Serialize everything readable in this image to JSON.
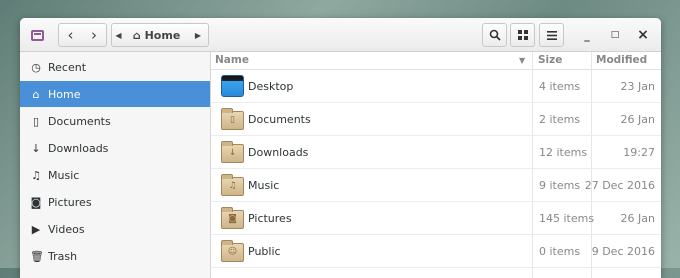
{
  "header": {
    "path_label": "Home",
    "window_controls": {
      "minimize": "_",
      "maximize": "□",
      "close": "×"
    }
  },
  "sidebar": {
    "items": [
      {
        "label": "Recent",
        "icon": "clock-icon"
      },
      {
        "label": "Home",
        "icon": "home-icon",
        "selected": true
      },
      {
        "label": "Documents",
        "icon": "document-icon"
      },
      {
        "label": "Downloads",
        "icon": "download-icon"
      },
      {
        "label": "Music",
        "icon": "music-icon"
      },
      {
        "label": "Pictures",
        "icon": "camera-icon"
      },
      {
        "label": "Videos",
        "icon": "video-icon"
      },
      {
        "label": "Trash",
        "icon": "trash-icon"
      }
    ]
  },
  "list": {
    "columns": {
      "name": "Name",
      "size": "Size",
      "modified": "Modified"
    },
    "rows": [
      {
        "name": "Desktop",
        "size": "4 items",
        "modified": "23 Jan",
        "icon": "desktop-folder-icon"
      },
      {
        "name": "Documents",
        "size": "2 items",
        "modified": "26 Jan",
        "icon": "documents-folder-icon"
      },
      {
        "name": "Downloads",
        "size": "12 items",
        "modified": "19:27",
        "icon": "downloads-folder-icon"
      },
      {
        "name": "Music",
        "size": "9 items",
        "modified": "27 Dec 2016",
        "icon": "music-folder-icon"
      },
      {
        "name": "Pictures",
        "size": "145 items",
        "modified": "26 Jan",
        "icon": "pictures-folder-icon"
      },
      {
        "name": "Public",
        "size": "0 items",
        "modified": "9 Dec 2016",
        "icon": "public-folder-icon"
      }
    ]
  },
  "colors": {
    "accent": "#4a90d9",
    "folder": "#cdb48b"
  }
}
